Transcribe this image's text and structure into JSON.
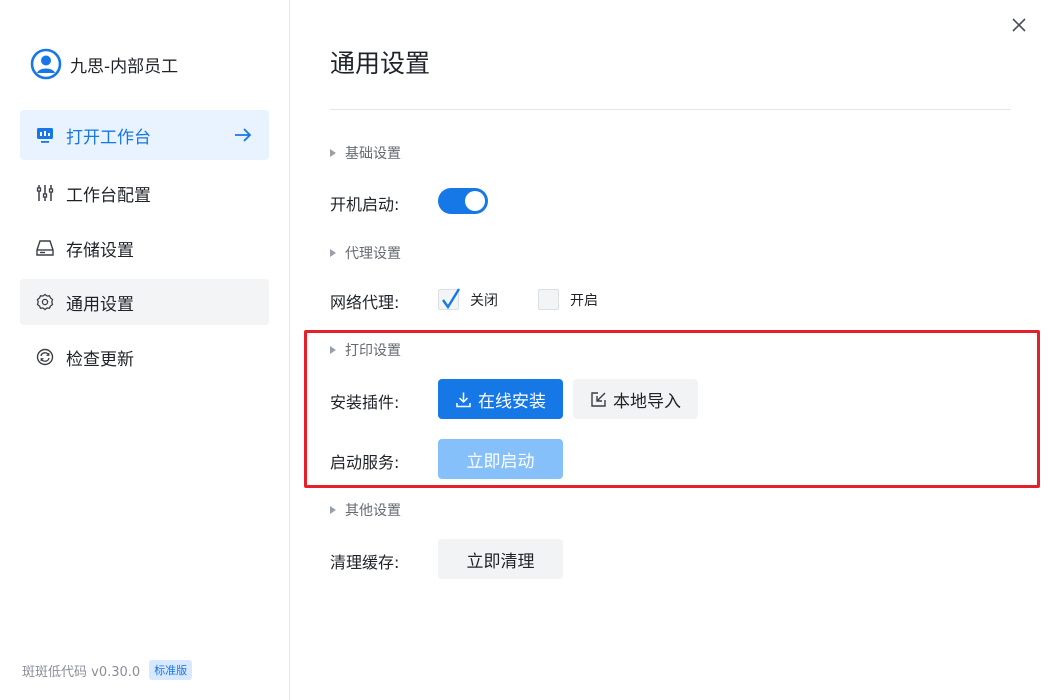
{
  "window": {
    "close_icon": "close-icon"
  },
  "sidebar": {
    "user_name": "九思-内部员工",
    "items": [
      {
        "label": "打开工作台",
        "icon": "monitor-icon"
      },
      {
        "label": "工作台配置",
        "icon": "sliders-icon"
      },
      {
        "label": "存储设置",
        "icon": "hard-drive-icon"
      },
      {
        "label": "通用设置",
        "icon": "gear-icon"
      },
      {
        "label": "检查更新",
        "icon": "refresh-icon"
      }
    ],
    "version": "斑斑低代码 v0.30.0",
    "edition_badge": "标准版"
  },
  "main": {
    "title": "通用设置",
    "sections": {
      "basic": "基础设置",
      "proxy": "代理设置",
      "print": "打印设置",
      "other": "其他设置"
    },
    "startup": {
      "label": "开机启动:",
      "enabled": true
    },
    "proxy": {
      "label": "网络代理:",
      "options": [
        {
          "label": "关闭",
          "checked": true
        },
        {
          "label": "开启",
          "checked": false
        }
      ]
    },
    "plugin": {
      "label": "安装插件:",
      "online_install": "在线安装",
      "local_import": "本地导入"
    },
    "service": {
      "label": "启动服务:",
      "start_now": "立即启动"
    },
    "cache": {
      "label": "清理缓存:",
      "clear_now": "立即清理"
    }
  },
  "colors": {
    "accent": "#1677e6",
    "active_bg": "#e8f3ff",
    "highlight_border": "#e5202a"
  }
}
